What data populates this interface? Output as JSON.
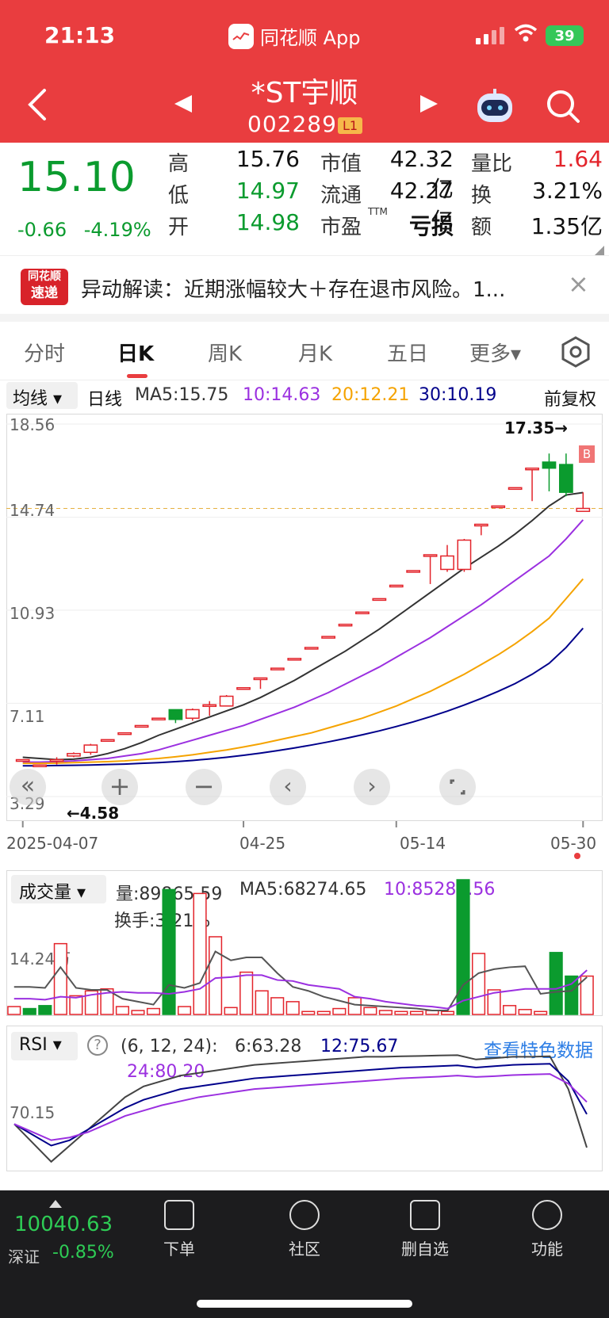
{
  "status": {
    "time": "21:13",
    "app_name": "同花顺 App",
    "battery": "39"
  },
  "header": {
    "stock_name": "*ST宇顺",
    "stock_code": "002289",
    "level": "L1"
  },
  "quote": {
    "price": "15.10",
    "change": "-0.66",
    "change_pct": "-4.19%",
    "rows": [
      {
        "l1": "高",
        "v1": "15.76",
        "l2": "市值",
        "v2": "42.32亿",
        "l3": "量比",
        "v3": "1.64"
      },
      {
        "l1": "低",
        "v1": "14.97",
        "l2": "流通",
        "v2": "42.27亿",
        "l3": "换",
        "v3": "3.21%"
      },
      {
        "l1": "开",
        "v1": "14.98",
        "l2": "市盈",
        "v2": "亏损",
        "l3": "额",
        "v3": "1.35亿",
        "ttm": "TTM"
      }
    ]
  },
  "alert": {
    "logo_line1": "同花顺",
    "logo_line2": "速递",
    "text": "异动解读：近期涨幅较大＋存在退市风险。1..."
  },
  "tabs": [
    "分时",
    "日K",
    "周K",
    "月K",
    "五日",
    "更多▾"
  ],
  "active_tab": "日K",
  "ma_bar": {
    "select": "均线 ▾",
    "line": "日线",
    "ma5": "MA5:15.75",
    "ma10": "10:14.63",
    "ma20": "20:12.21",
    "ma30": "30:10.19",
    "adjust": "前复权"
  },
  "kline": {
    "y_ticks": [
      "18.56",
      "14.74",
      "10.93",
      "7.11",
      "3.29"
    ],
    "high_label": "17.35→",
    "low_label": "←4.58",
    "x_labels": [
      "2025-04-07",
      "04-25",
      "05-14",
      "05-30"
    ],
    "b_marker": "B"
  },
  "volume": {
    "select": "成交量 ▾",
    "vol": "量:89865.59",
    "ma5": "MA5:68274.65",
    "ma10": "10:85283.56",
    "turnover": "换手:3.21%",
    "y_tick": "14.24万"
  },
  "rsi": {
    "select": "RSI ▾",
    "params": "(6, 12, 24):",
    "r6": "6:63.28",
    "r12": "12:75.67",
    "r24": "24:80.20",
    "link": "查看特色数据",
    "y_tick": "70.15"
  },
  "index": {
    "value": "10040.63",
    "name": "深证",
    "change": "-0.85%"
  },
  "nav": [
    "下单",
    "社区",
    "删自选",
    "功能"
  ],
  "colors": {
    "brand": "#e93d3f",
    "up": "#e3242b",
    "down": "#0b9b2e",
    "ma10": "#9b30e0",
    "ma20": "#f5a300",
    "ma30": "#00008b"
  },
  "chart_data": [
    {
      "type": "candlestick",
      "title": "日K",
      "y_ticks": [
        18.56,
        14.74,
        10.93,
        7.11,
        3.29
      ],
      "ylim": [
        3.29,
        18.56
      ],
      "x_labels": [
        "2025-04-07",
        "04-25",
        "05-14",
        "05-30"
      ],
      "candles": [
        {
          "o": 4.8,
          "c": 4.8,
          "h": 4.8,
          "l": 4.8
        },
        {
          "o": 4.58,
          "c": 4.58,
          "h": 4.6,
          "l": 4.58
        },
        {
          "o": 4.75,
          "c": 4.8,
          "h": 4.9,
          "l": 4.6
        },
        {
          "o": 4.95,
          "c": 5.05,
          "h": 5.1,
          "l": 4.9
        },
        {
          "o": 5.1,
          "c": 5.4,
          "h": 5.45,
          "l": 5.0
        },
        {
          "o": 5.62,
          "c": 5.62,
          "h": 5.62,
          "l": 5.62
        },
        {
          "o": 5.9,
          "c": 5.9,
          "h": 5.9,
          "l": 5.9
        },
        {
          "o": 6.2,
          "c": 6.2,
          "h": 6.2,
          "l": 6.2
        },
        {
          "o": 6.5,
          "c": 6.5,
          "h": 6.5,
          "l": 6.5
        },
        {
          "o": 6.85,
          "c": 6.45,
          "h": 6.85,
          "l": 6.3
        },
        {
          "o": 6.5,
          "c": 6.85,
          "h": 6.9,
          "l": 6.4
        },
        {
          "o": 7.05,
          "c": 7.05,
          "h": 7.2,
          "l": 6.6
        },
        {
          "o": 7.0,
          "c": 7.4,
          "h": 7.45,
          "l": 7.0
        },
        {
          "o": 7.75,
          "c": 7.75,
          "h": 7.75,
          "l": 7.75
        },
        {
          "o": 8.15,
          "c": 8.15,
          "h": 8.15,
          "l": 7.7
        },
        {
          "o": 8.55,
          "c": 8.55,
          "h": 8.55,
          "l": 8.55
        },
        {
          "o": 8.95,
          "c": 8.95,
          "h": 8.95,
          "l": 8.95
        },
        {
          "o": 9.4,
          "c": 9.4,
          "h": 9.4,
          "l": 9.4
        },
        {
          "o": 9.85,
          "c": 9.85,
          "h": 9.85,
          "l": 9.85
        },
        {
          "o": 10.35,
          "c": 10.35,
          "h": 10.35,
          "l": 10.35
        },
        {
          "o": 10.85,
          "c": 10.85,
          "h": 10.85,
          "l": 10.85
        },
        {
          "o": 11.4,
          "c": 11.4,
          "h": 11.4,
          "l": 11.4
        },
        {
          "o": 11.95,
          "c": 11.95,
          "h": 11.95,
          "l": 11.95
        },
        {
          "o": 12.55,
          "c": 12.55,
          "h": 12.55,
          "l": 12.55
        },
        {
          "o": 13.2,
          "c": 13.2,
          "h": 13.2,
          "l": 12.0
        },
        {
          "o": 12.6,
          "c": 13.15,
          "h": 13.6,
          "l": 12.5
        },
        {
          "o": 12.6,
          "c": 13.8,
          "h": 13.85,
          "l": 12.5
        },
        {
          "o": 14.45,
          "c": 14.45,
          "h": 14.45,
          "l": 14.0
        },
        {
          "o": 15.2,
          "c": 15.2,
          "h": 15.2,
          "l": 15.2
        },
        {
          "o": 15.95,
          "c": 15.95,
          "h": 15.95,
          "l": 15.95
        },
        {
          "o": 16.75,
          "c": 16.75,
          "h": 16.75,
          "l": 15.4
        },
        {
          "o": 17.0,
          "c": 16.75,
          "h": 17.35,
          "l": 15.8
        },
        {
          "o": 16.9,
          "c": 15.76,
          "h": 17.35,
          "l": 15.6
        },
        {
          "o": 14.98,
          "c": 15.1,
          "h": 15.76,
          "l": 14.97
        }
      ],
      "series": [
        {
          "name": "MA5",
          "values": [
            4.9,
            4.85,
            4.8,
            4.82,
            4.9,
            5.05,
            5.25,
            5.5,
            5.8,
            6.05,
            6.3,
            6.55,
            6.8,
            7.05,
            7.35,
            7.7,
            8.05,
            8.45,
            8.85,
            9.25,
            9.7,
            10.15,
            10.65,
            11.15,
            11.65,
            12.15,
            12.65,
            13.1,
            13.55,
            14.05,
            14.6,
            15.2,
            15.65,
            15.75
          ]
        },
        {
          "name": "10",
          "values": [
            4.7,
            4.7,
            4.72,
            4.75,
            4.8,
            4.85,
            4.95,
            5.05,
            5.2,
            5.4,
            5.6,
            5.8,
            6.0,
            6.2,
            6.45,
            6.7,
            6.95,
            7.25,
            7.55,
            7.9,
            8.25,
            8.6,
            9.0,
            9.4,
            9.8,
            10.25,
            10.7,
            11.15,
            11.65,
            12.15,
            12.65,
            13.15,
            13.85,
            14.63
          ]
        },
        {
          "name": "20",
          "values": [
            4.65,
            4.65,
            4.66,
            4.68,
            4.7,
            4.72,
            4.75,
            4.8,
            4.85,
            4.92,
            5.0,
            5.1,
            5.2,
            5.32,
            5.45,
            5.6,
            5.75,
            5.9,
            6.1,
            6.3,
            6.5,
            6.75,
            7.0,
            7.3,
            7.6,
            7.95,
            8.3,
            8.7,
            9.1,
            9.55,
            10.05,
            10.6,
            11.4,
            12.21
          ]
        },
        {
          "name": "30",
          "values": [
            4.55,
            4.55,
            4.56,
            4.57,
            4.58,
            4.6,
            4.62,
            4.65,
            4.68,
            4.72,
            4.77,
            4.83,
            4.9,
            4.98,
            5.07,
            5.17,
            5.28,
            5.4,
            5.53,
            5.67,
            5.82,
            5.98,
            6.16,
            6.35,
            6.56,
            6.79,
            7.04,
            7.31,
            7.6,
            7.92,
            8.3,
            8.75,
            9.4,
            10.19
          ]
        }
      ]
    },
    {
      "type": "bar",
      "title": "成交量",
      "y_ticks": [
        142400
      ],
      "values": [
        8000,
        6000,
        9000,
        72000,
        19000,
        24000,
        26000,
        8000,
        4000,
        6000,
        127000,
        8000,
        123000,
        79000,
        7000,
        43000,
        24000,
        17000,
        13000,
        3000,
        3000,
        6000,
        17000,
        7000,
        4000,
        3000,
        3000,
        4000,
        3000,
        137000,
        62000,
        25000,
        9000,
        5000,
        3000,
        63000,
        39000,
        39000
      ],
      "down_flags": [
        0,
        1,
        1,
        0,
        0,
        0,
        0,
        0,
        0,
        0,
        1,
        0,
        0,
        0,
        0,
        0,
        0,
        0,
        0,
        0,
        0,
        0,
        0,
        0,
        0,
        0,
        0,
        0,
        0,
        1,
        0,
        0,
        0,
        0,
        0,
        1,
        1,
        0
      ],
      "series": [
        {
          "name": "MA5",
          "values": [
            28000,
            28000,
            27000,
            48000,
            27000,
            25000,
            25000,
            16000,
            13000,
            10000,
            30000,
            27000,
            32000,
            64000,
            55000,
            58000,
            58000,
            42000,
            28000,
            24000,
            18000,
            14000,
            10000,
            9000,
            8000,
            7000,
            6000,
            4000,
            4000,
            30000,
            42000,
            46000,
            48000,
            49000,
            21000,
            23000,
            24000,
            38000
          ]
        },
        {
          "name": "10",
          "values": [
            16000,
            16000,
            15000,
            18000,
            17000,
            20000,
            22000,
            23000,
            22000,
            22000,
            21000,
            23000,
            26000,
            37000,
            38000,
            40000,
            40000,
            35000,
            34000,
            30000,
            28000,
            26000,
            18000,
            16000,
            13000,
            11000,
            9000,
            8000,
            6000,
            14000,
            18000,
            22000,
            24000,
            26000,
            26000,
            26000,
            31000,
            45000
          ]
        }
      ]
    },
    {
      "type": "line",
      "title": "RSI",
      "y_ticks": [
        70.15
      ],
      "series": [
        {
          "name": "6",
          "values": [
            72,
            65,
            58,
            64,
            70,
            76,
            82,
            86,
            88,
            90,
            91,
            92,
            93,
            94,
            94.5,
            95,
            95.5,
            96,
            96.5,
            97,
            97,
            97.2,
            97.3,
            97.5,
            97.6,
            96,
            96.5,
            97,
            97,
            97.2,
            85,
            63.28
          ]
        },
        {
          "name": "12",
          "values": [
            72,
            68,
            64,
            66,
            70,
            74,
            78,
            81,
            83,
            85,
            86,
            87,
            88,
            89,
            89.5,
            90,
            90.5,
            91,
            91.5,
            92,
            92.5,
            93,
            93.2,
            93.5,
            93.8,
            93,
            93.5,
            94,
            94.2,
            94.4,
            88,
            75.67
          ]
        },
        {
          "name": "24",
          "values": [
            72,
            69,
            66,
            67,
            69,
            72,
            75,
            77,
            79,
            80.5,
            82,
            83,
            84,
            85,
            85.5,
            86,
            86.5,
            87,
            87.5,
            88,
            88.5,
            89,
            89.3,
            89.6,
            90,
            89.5,
            89.8,
            90.2,
            90.4,
            90.6,
            87,
            80.2
          ]
        }
      ]
    }
  ]
}
